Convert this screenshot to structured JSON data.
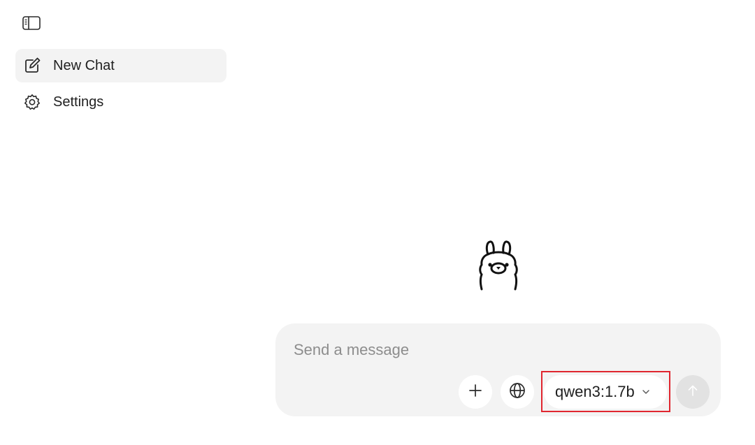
{
  "sidebar": {
    "toggle_icon": "sidebar-toggle-icon",
    "items": [
      {
        "label": "New Chat",
        "icon": "compose-icon",
        "active": true
      },
      {
        "label": "Settings",
        "icon": "gear-icon",
        "active": false
      }
    ]
  },
  "main": {
    "logo_icon": "llama-logo-icon",
    "composer": {
      "placeholder": "Send a message",
      "value": "",
      "attach_icon": "plus-icon",
      "web_search_icon": "globe-icon",
      "model": {
        "selected": "qwen3:1.7b",
        "dropdown_icon": "chevron-down-icon"
      },
      "send_icon": "arrow-up-icon"
    }
  },
  "colors": {
    "active_item_bg": "#f3f3f3",
    "composer_bg": "#f3f3f3",
    "send_button_bg": "#e2e2e2",
    "highlight": "#e0262f"
  }
}
